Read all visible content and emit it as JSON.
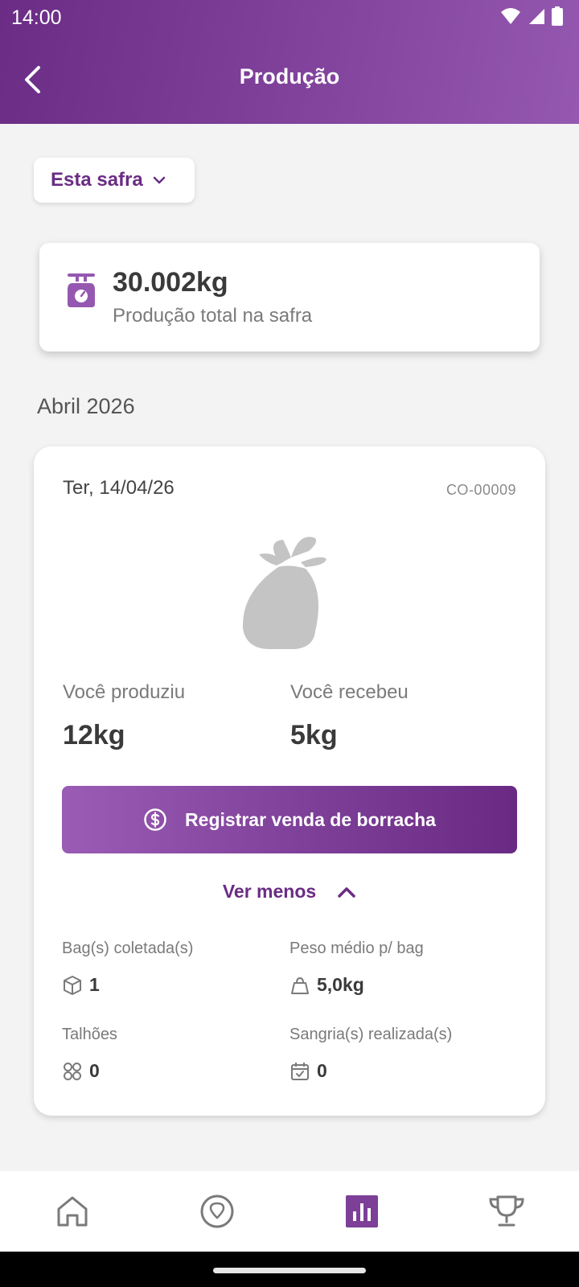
{
  "status_bar": {
    "time": "14:00",
    "icons": [
      "wifi-icon",
      "signal-icon",
      "battery-icon"
    ]
  },
  "header": {
    "title": "Produção",
    "back_icon": "chevron-left-icon"
  },
  "filter": {
    "label": "Esta safra",
    "icon": "chevron-down-icon"
  },
  "total": {
    "icon": "scale-icon",
    "value": "30.002kg",
    "caption": "Produção total na safra"
  },
  "month": "Abril 2026",
  "record": {
    "date": "Ter, 14/04/26",
    "code": "CO-00009",
    "illustration": "bag-illustration",
    "produced_label": "Você produziu",
    "produced_value": "12kg",
    "received_label": "Você recebeu",
    "received_value": "5kg",
    "sale_button": {
      "icon": "dollar-circle-icon",
      "label": "Registrar venda de borracha"
    },
    "toggle": {
      "label": "Ver menos",
      "icon": "chevron-up-icon"
    },
    "details": [
      {
        "label": "Bag(s) coletada(s)",
        "icon": "cube-icon",
        "value": "1"
      },
      {
        "label": "Peso médio p/ bag",
        "icon": "weight-icon",
        "value": "5,0kg"
      },
      {
        "label": "Talhões",
        "icon": "grid-circles-icon",
        "value": "0"
      },
      {
        "label": "Sangria(s) realizada(s)",
        "icon": "calendar-check-icon",
        "value": "0"
      }
    ]
  },
  "bottom_nav": {
    "items": [
      {
        "icon": "home-icon",
        "active": false
      },
      {
        "icon": "location-pin-icon",
        "active": false
      },
      {
        "icon": "bar-chart-icon",
        "active": true
      },
      {
        "icon": "trophy-icon",
        "active": false
      }
    ]
  },
  "colors": {
    "brand": "#6a2c84",
    "brand_light": "#9558b0",
    "background": "#f3f3f4",
    "icon_gray": "#7a7a7a"
  }
}
